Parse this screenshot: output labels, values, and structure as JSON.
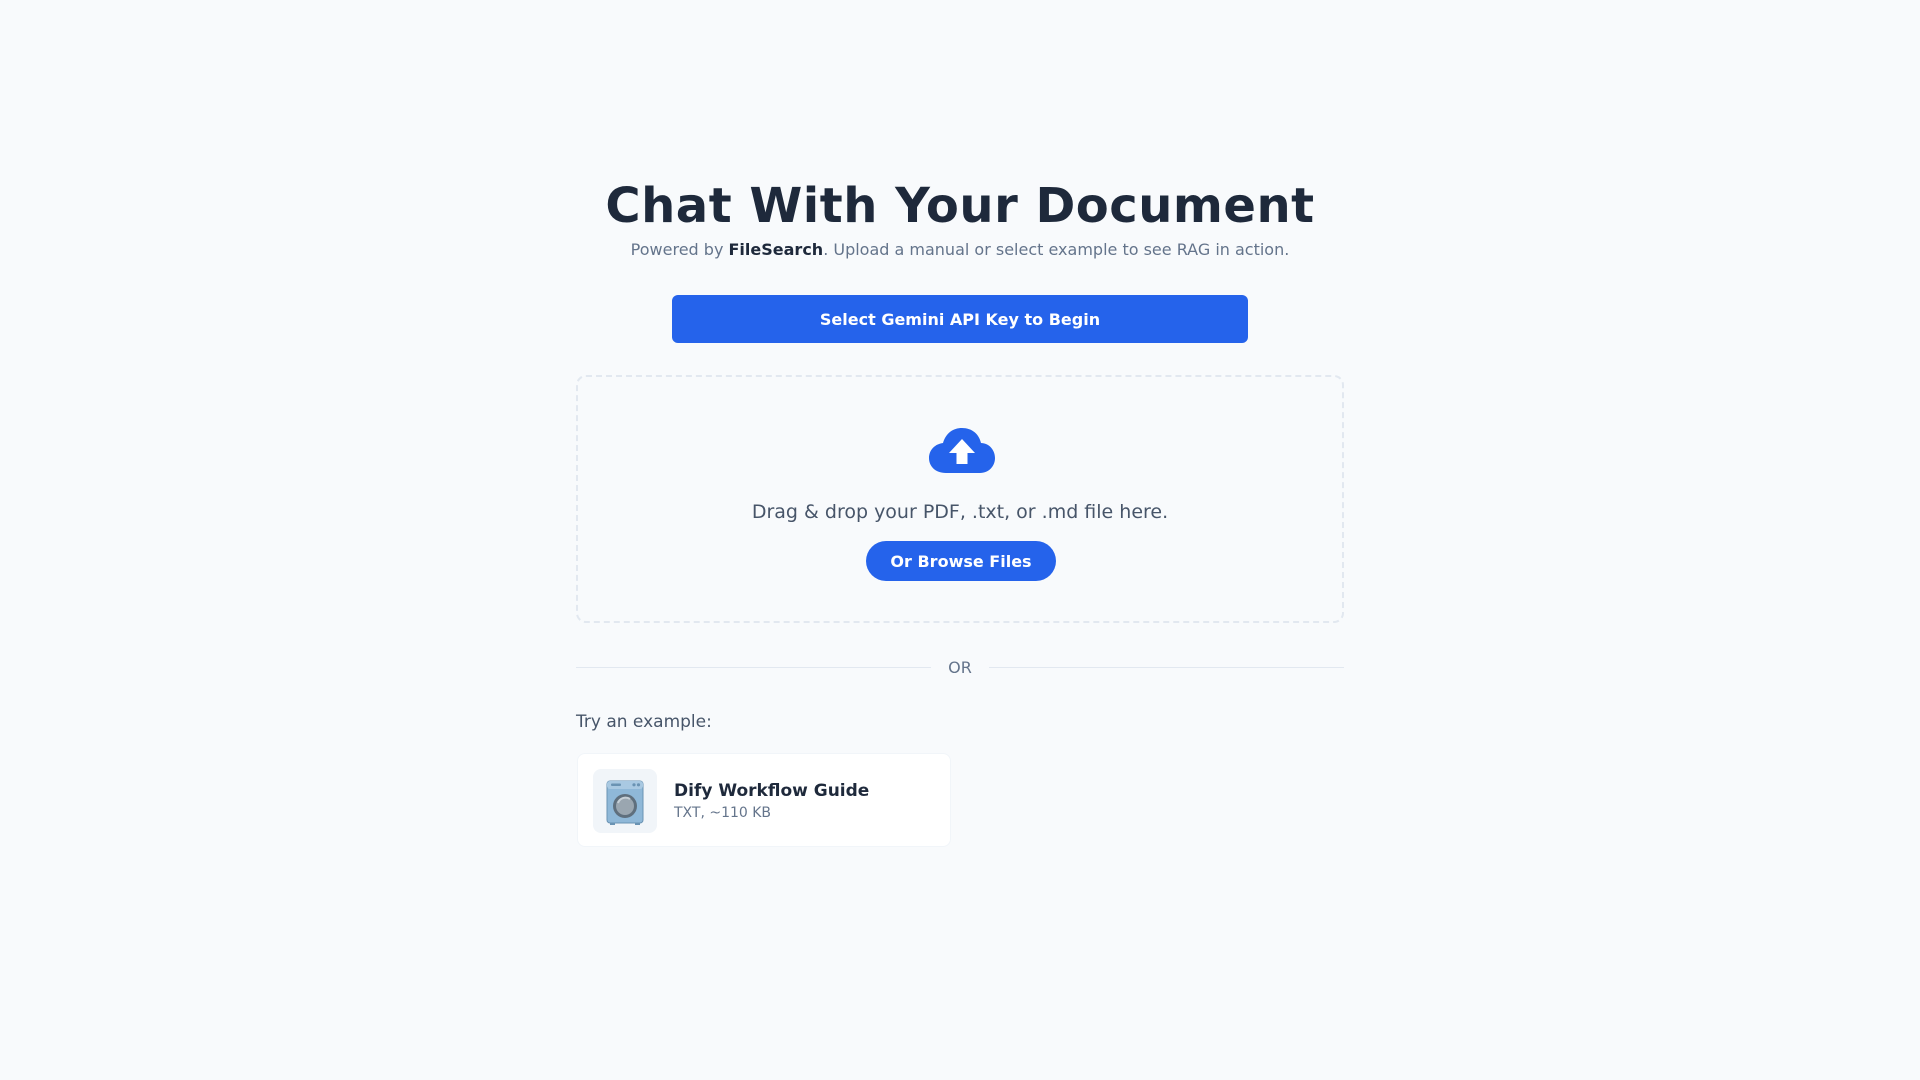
{
  "header": {
    "title": "Chat With Your Document",
    "subtitle_prefix": "Powered by ",
    "subtitle_brand": "FileSearch",
    "subtitle_suffix": ". Upload a manual or select example to see RAG in action."
  },
  "api_button": {
    "label": "Select Gemini API Key to Begin"
  },
  "dropzone": {
    "icon": "cloud-upload-icon",
    "text": "Drag & drop your PDF, .txt, or .md file here.",
    "browse_label": "Or Browse Files"
  },
  "divider": {
    "text": "OR"
  },
  "examples": {
    "label": "Try an example:",
    "items": [
      {
        "icon": "washing-machine-icon",
        "title": "Dify Workflow Guide",
        "meta": "TXT, ~110 KB"
      }
    ]
  },
  "colors": {
    "accent": "#2563eb",
    "background": "#f8fafc",
    "heading": "#1e293b",
    "muted": "#64748b"
  }
}
